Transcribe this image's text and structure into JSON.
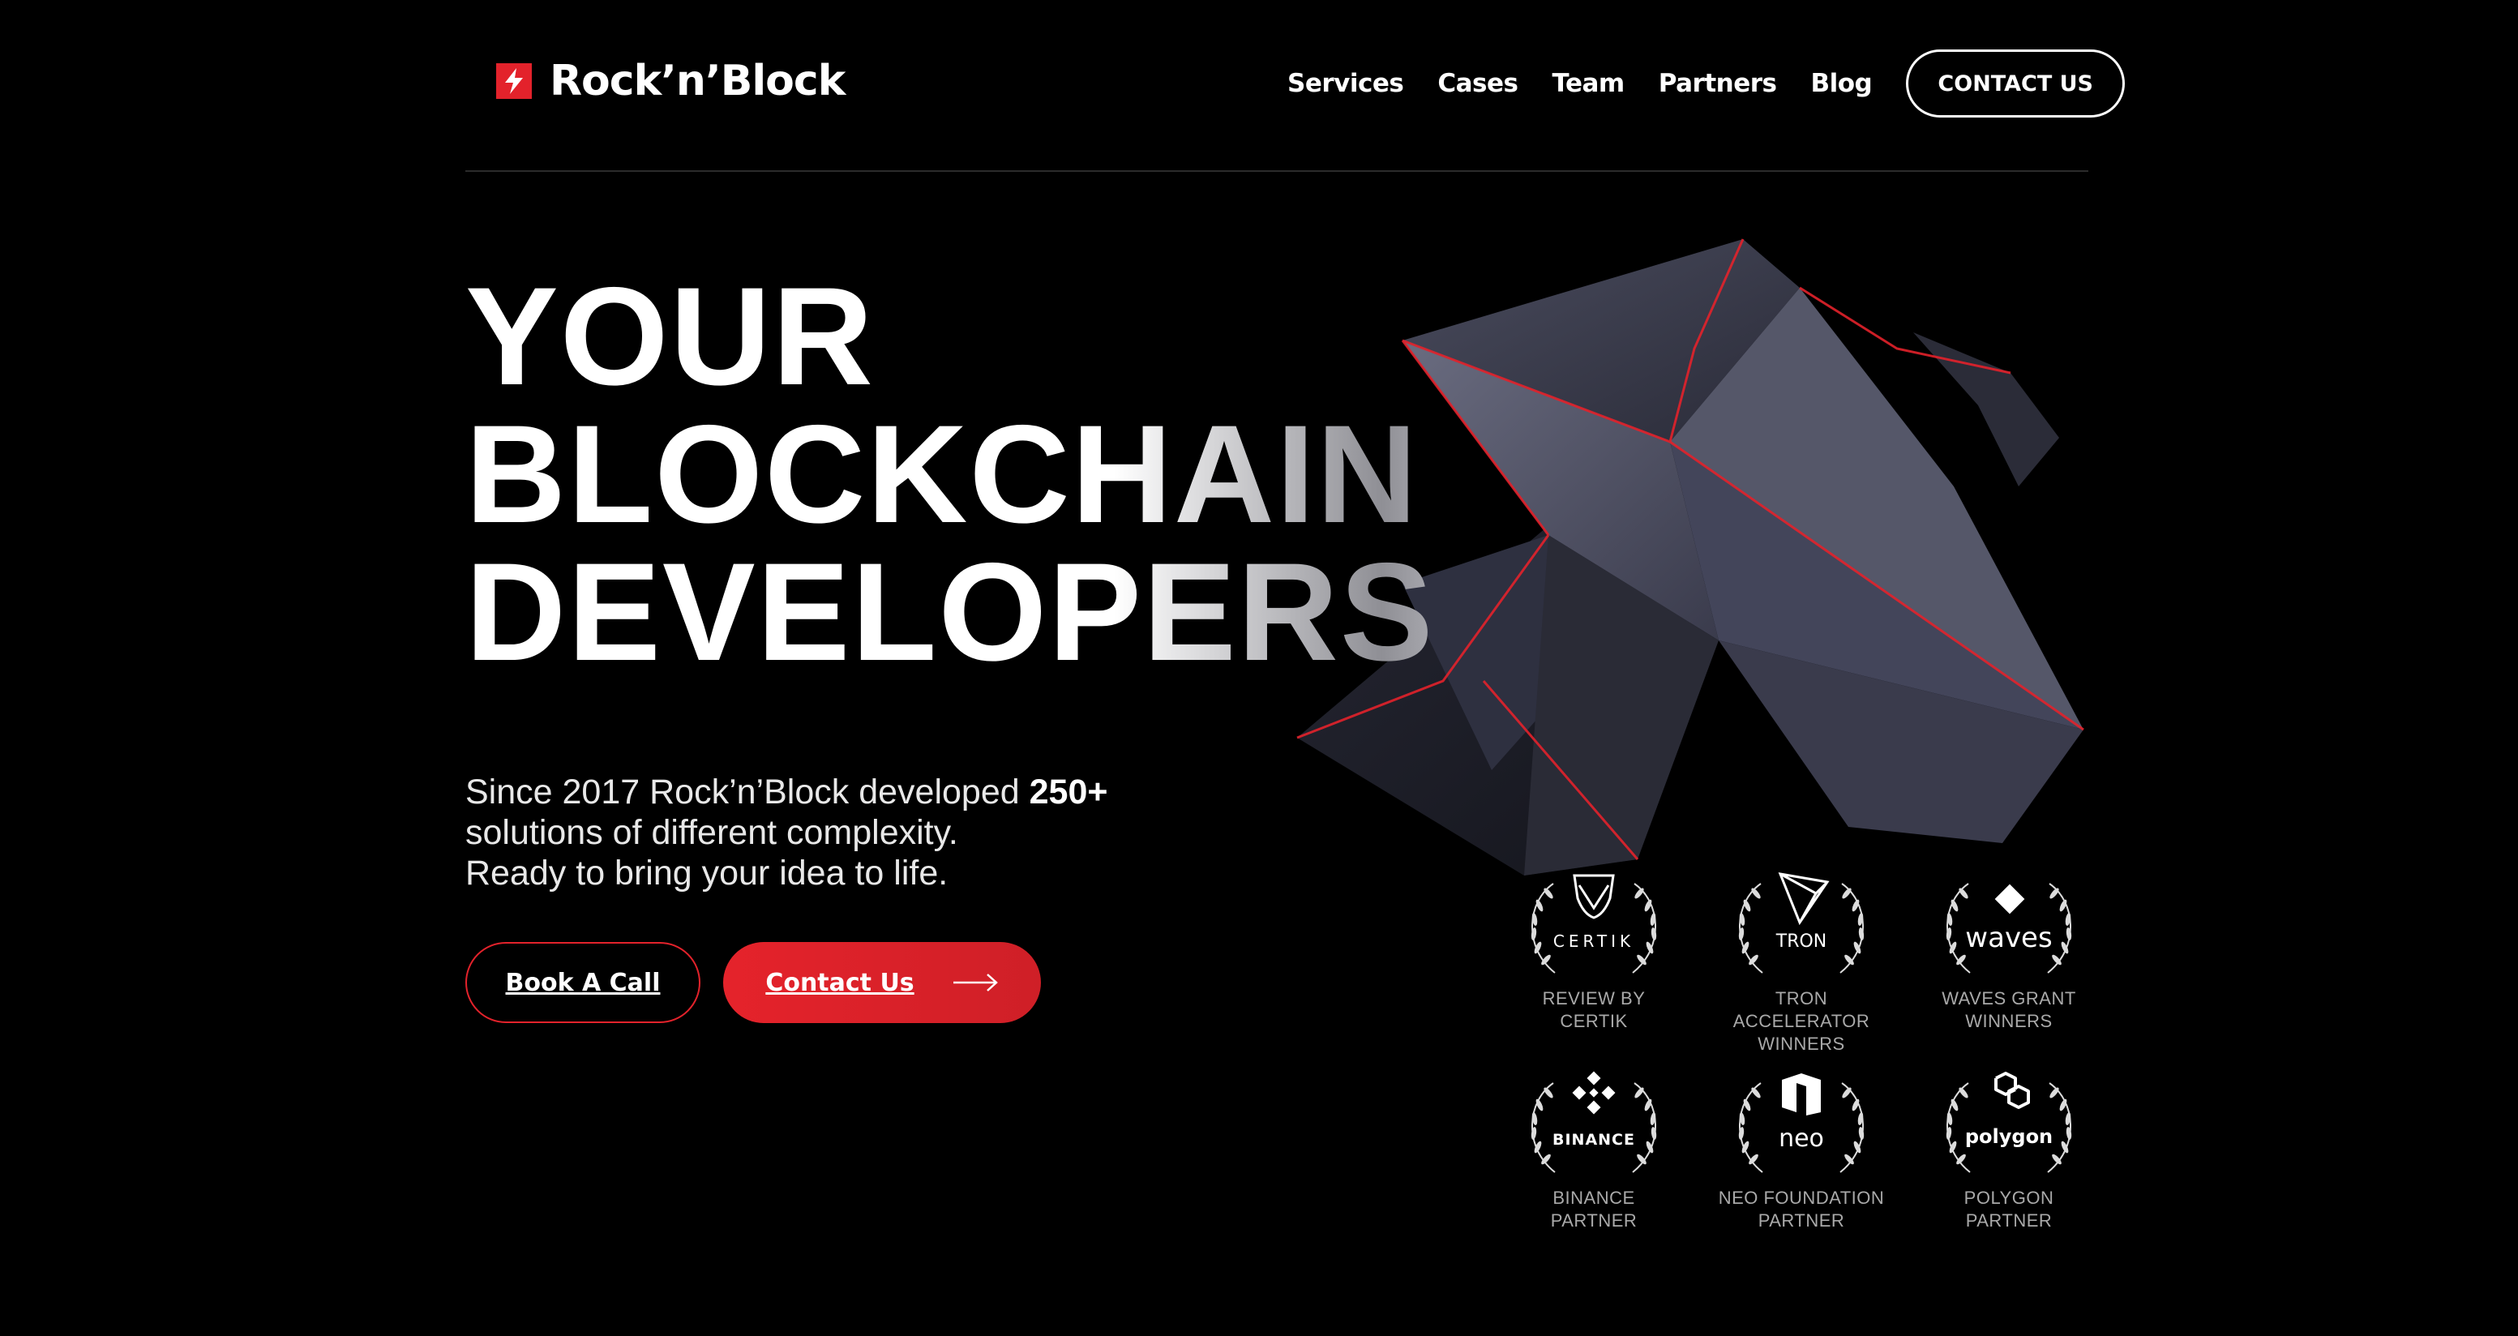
{
  "brand": {
    "name": "Rock’n’Block"
  },
  "nav": {
    "items": [
      "Services",
      "Cases",
      "Team",
      "Partners",
      "Blog"
    ],
    "contact_label": "CONTACT US"
  },
  "hero": {
    "title_lines": [
      "YOUR",
      "BLOCKCHAIN",
      "DEVELOPERS"
    ],
    "subtitle_line1_prefix": "Since 2017 Rock’n’Block developed",
    "subtitle_line1_bold": "250+",
    "subtitle_line2": "solutions of different complexity.",
    "subtitle_line3": "Ready to bring your idea to life.",
    "book_label": "Book A Call",
    "contact_label": "Contact Us"
  },
  "awards": [
    {
      "logo_text": "CERTIK",
      "caption_line1": "REVIEW BY",
      "caption_line2": "CERTIK",
      "icon": "certik-shield-icon"
    },
    {
      "logo_text": "TRON",
      "caption_line1": "TRON ACCELERATOR",
      "caption_line2": "WINNERS",
      "icon": "tron-logo-icon"
    },
    {
      "logo_text": "waves",
      "caption_line1": "WAVES GRANT",
      "caption_line2": "WINNERS",
      "icon": "waves-diamond-icon"
    },
    {
      "logo_text": "BINANCE",
      "caption_line1": "BINANCE",
      "caption_line2": "PARTNER",
      "icon": "binance-logo-icon"
    },
    {
      "logo_text": "neo",
      "caption_line1": "NEO FOUNDATION",
      "caption_line2": "PARTNER",
      "icon": "neo-logo-icon"
    },
    {
      "logo_text": "polygon",
      "caption_line1": "POLYGON",
      "caption_line2": "PARTNER",
      "icon": "polygon-logo-icon"
    }
  ],
  "colors": {
    "accent": "#e3222b",
    "background": "#000000",
    "text": "#ffffff",
    "muted": "#a9a9a9"
  }
}
